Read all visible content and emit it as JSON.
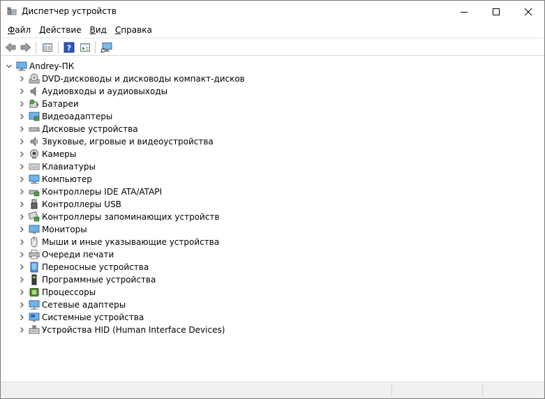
{
  "window": {
    "title": "Диспетчер устройств",
    "controls": [
      "minimize-button",
      "maximize-button",
      "close-button"
    ]
  },
  "menu": [
    {
      "accel": "Ф",
      "rest": "айл"
    },
    {
      "accel": "Д",
      "rest": "ействие"
    },
    {
      "accel": "В",
      "rest": "ид"
    },
    {
      "accel": "С",
      "rest": "правка"
    }
  ],
  "toolbar": [
    "back-icon",
    "forward-icon",
    "properties-icon",
    "help-icon",
    "action-pane-icon",
    "scan-hardware-icon"
  ],
  "tree": {
    "root": "Andrey-ПК",
    "items": [
      {
        "label": "DVD-дисководы и дисководы компакт-дисков",
        "icon": "dvd-drive-icon"
      },
      {
        "label": "Аудиовходы и аудиовыходы",
        "icon": "speaker-icon"
      },
      {
        "label": "Батареи",
        "icon": "battery-icon"
      },
      {
        "label": "Видеоадаптеры",
        "icon": "display-adapter-icon"
      },
      {
        "label": "Дисковые устройства",
        "icon": "disk-drive-icon"
      },
      {
        "label": "Звуковые, игровые и видеоустройства",
        "icon": "sound-icon"
      },
      {
        "label": "Камеры",
        "icon": "camera-icon"
      },
      {
        "label": "Клавиатуры",
        "icon": "keyboard-icon"
      },
      {
        "label": "Компьютер",
        "icon": "computer-icon"
      },
      {
        "label": "Контроллеры IDE ATA/ATAPI",
        "icon": "ide-controller-icon"
      },
      {
        "label": "Контроллеры USB",
        "icon": "usb-icon"
      },
      {
        "label": "Контроллеры запоминающих устройств",
        "icon": "storage-controller-icon"
      },
      {
        "label": "Мониторы",
        "icon": "monitor-icon"
      },
      {
        "label": "Мыши и иные указывающие устройства",
        "icon": "mouse-icon"
      },
      {
        "label": "Очереди печати",
        "icon": "printer-icon"
      },
      {
        "label": "Переносные устройства",
        "icon": "portable-device-icon"
      },
      {
        "label": "Программные устройства",
        "icon": "software-device-icon"
      },
      {
        "label": "Процессоры",
        "icon": "processor-icon"
      },
      {
        "label": "Сетевые адаптеры",
        "icon": "network-adapter-icon"
      },
      {
        "label": "Системные устройства",
        "icon": "system-device-icon"
      },
      {
        "label": "Устройства HID (Human Interface Devices)",
        "icon": "hid-icon"
      }
    ]
  }
}
